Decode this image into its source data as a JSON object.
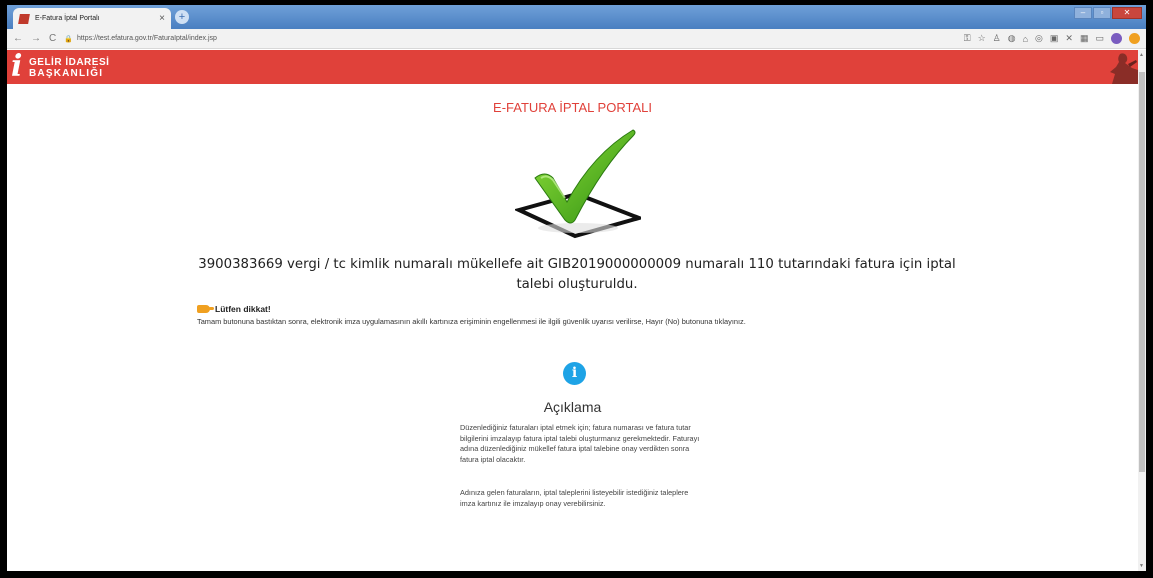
{
  "browser": {
    "tab_title": "E-Fatura İptal Portalı",
    "tab_close": "×",
    "new_tab": "+",
    "url": "https://test.efatura.gov.tr/FaturaIptal/index.jsp",
    "window_controls": [
      "–",
      "▫",
      "✕"
    ]
  },
  "header": {
    "logo_letter": "i",
    "logo_line1": "GELİR İDARESİ",
    "logo_line2": "BAŞKANLIĞI",
    "color": "#e0413a"
  },
  "page": {
    "title": "E-FATURA İPTAL PORTALI",
    "message": "3900383669 vergi / tc kimlik numaralı mükellefe ait GIB2019000000009 numaralı 110 tutarındaki fatura için iptal talebi oluşturuldu.",
    "notice_heading": "Lütfen dikkat!",
    "notice_text": "Tamam butonuna bastıktan sonra, elektronik imza uygulamasının akıllı kartınıza erişiminin engellenmesi ile ilgili güvenlik uyarısı verilirse, Hayır (No) butonuna tıklayınız.",
    "info_symbol": "i",
    "description_title": "Açıklama",
    "description_p1": "Düzenlediğiniz faturaları iptal etmek için; fatura numarası ve fatura tutar bilgilerini imzalayıp fatura iptal talebi oluşturmanız gerekmektedir. Faturayı adına düzenlediğiniz mükellef fatura iptal talebine onay verdikten sonra fatura iptal olacaktır.",
    "description_p2": "Adınıza gelen faturaların, iptal taleplerini listeyebilir istediğiniz taleplere imza kartınız ile imzalayıp onay verebilirsiniz."
  },
  "icons": {
    "success": "check-mark-icon",
    "info": "info-icon",
    "notice": "hand-pointing-icon"
  }
}
